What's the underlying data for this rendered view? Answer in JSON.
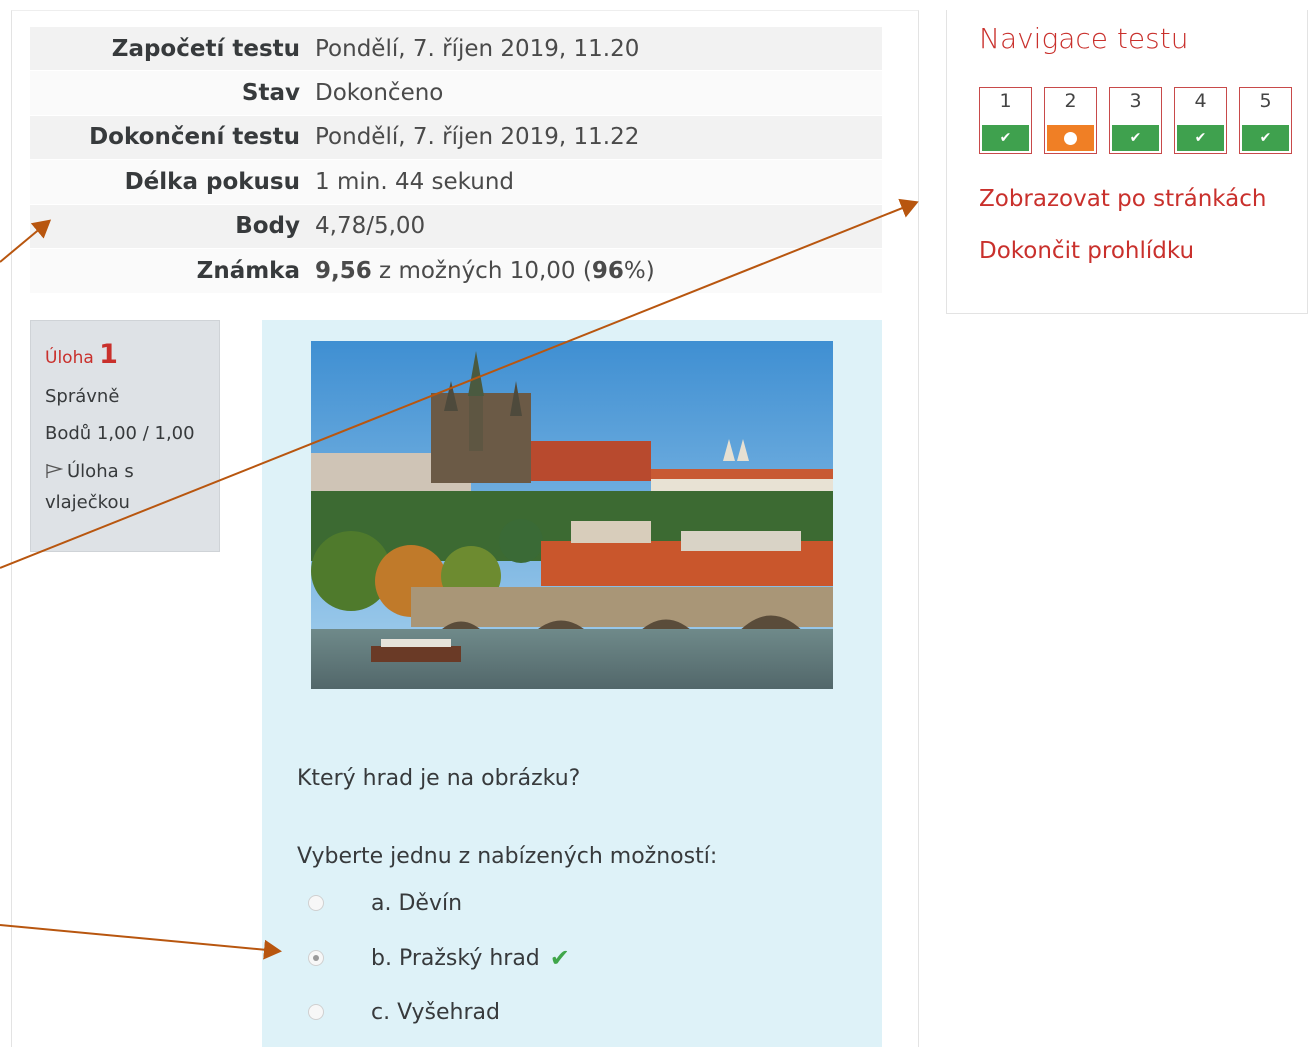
{
  "summary": {
    "rows": [
      {
        "label": "Započetí testu",
        "value": "Pondělí, 7. říjen 2019, 11.20"
      },
      {
        "label": "Stav",
        "value": "Dokončeno"
      },
      {
        "label": "Dokončení testu",
        "value": "Pondělí, 7. říjen 2019, 11.22"
      },
      {
        "label": "Délka pokusu",
        "value": "1 min. 44 sekund"
      },
      {
        "label": "Body",
        "value": "4,78/5,00"
      },
      {
        "label": "Známka",
        "grade_score": "9,56",
        "grade_mid": " z možných 10,00 (",
        "grade_percent": "96",
        "grade_end": "%)"
      }
    ]
  },
  "question_info": {
    "label": "Úloha",
    "number": "1",
    "state": "Správně",
    "marks": "Bodů 1,00 / 1,00",
    "flag_label": "Úloha s vlaječkou"
  },
  "question": {
    "text": "Který hrad je na obrázku?",
    "prompt": "Vyberte jednu z nabízených možností:",
    "answers": [
      {
        "label": "a. Děvín",
        "checked": false,
        "correct": false
      },
      {
        "label": "b. Pražský hrad",
        "checked": true,
        "correct": true
      },
      {
        "label": "c. Vyšehrad",
        "checked": false,
        "correct": false
      }
    ]
  },
  "navigation": {
    "title": "Navigace testu",
    "buttons": [
      {
        "number": "1",
        "state": "correct"
      },
      {
        "number": "2",
        "state": "partial"
      },
      {
        "number": "3",
        "state": "correct"
      },
      {
        "number": "4",
        "state": "correct"
      },
      {
        "number": "5",
        "state": "correct"
      }
    ],
    "show_one_page": "Zobrazovat po stránkách",
    "finish_review": "Dokončit prohlídku"
  },
  "colors": {
    "accent": "#c9302c",
    "correct": "#3fa14e",
    "partial": "#f07f25",
    "question_bg": "#def2f8",
    "arrow": "#b8560f"
  }
}
